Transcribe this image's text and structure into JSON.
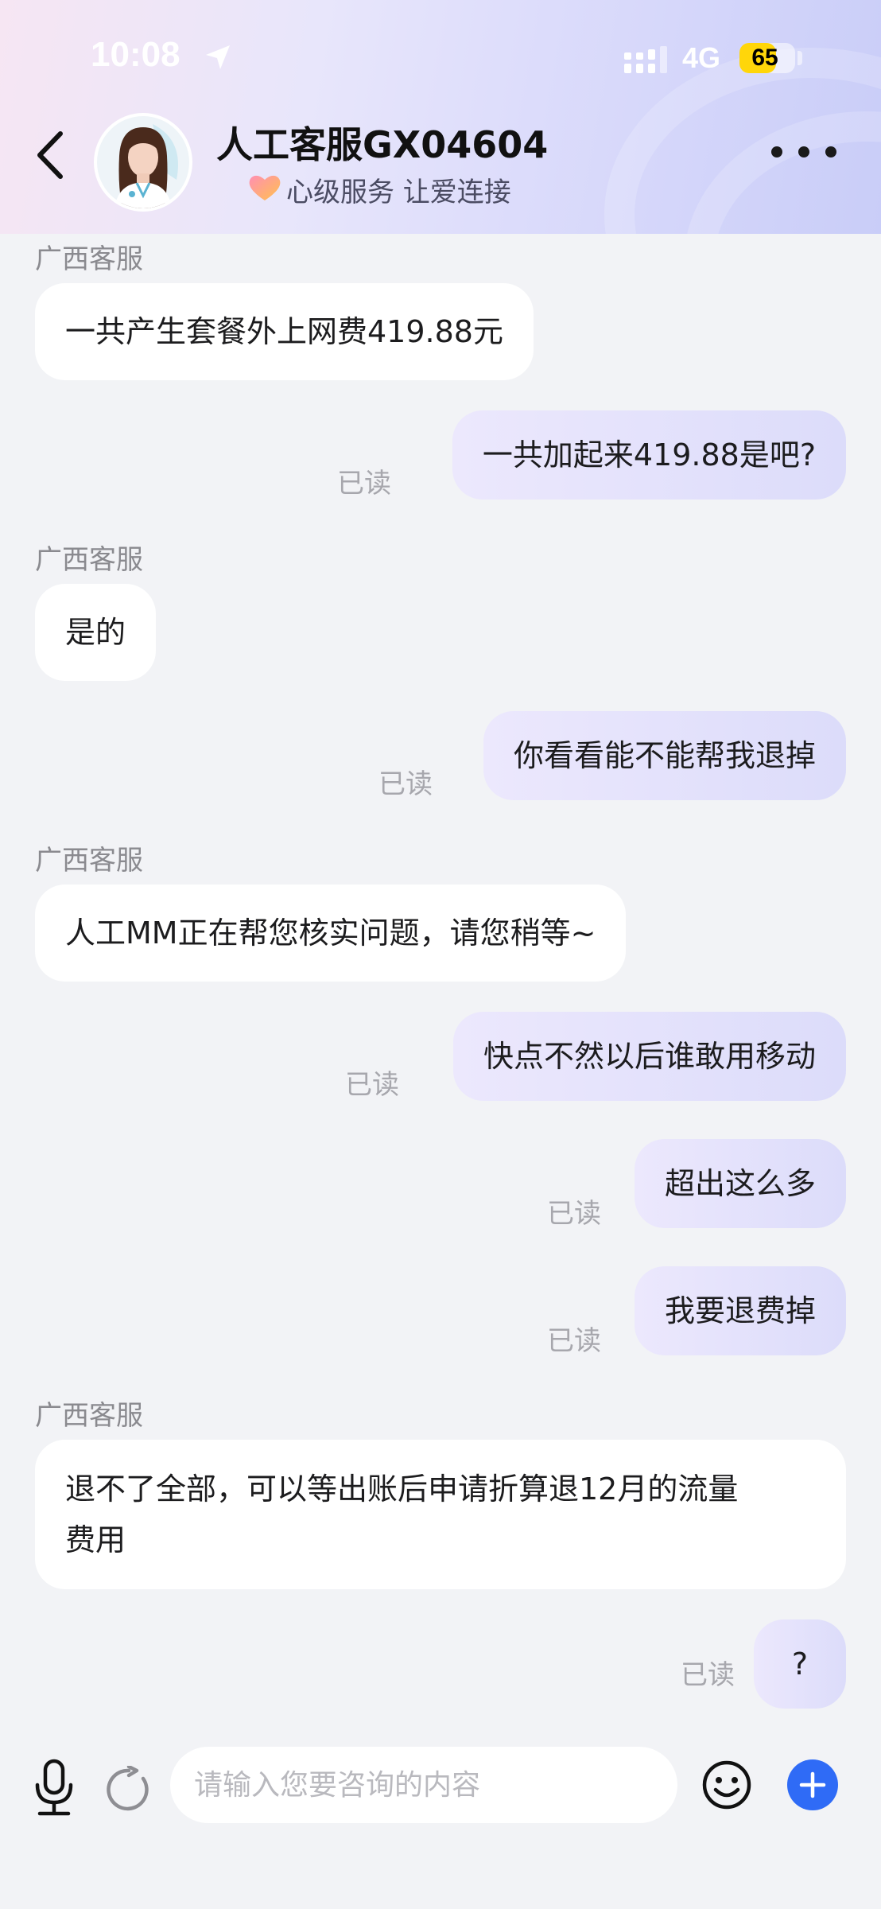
{
  "status_bar": {
    "time": "10:08",
    "network": "4G",
    "battery": "65",
    "battery_level": 0.65
  },
  "header": {
    "title": "人工客服GX04604",
    "subtitle": "心级服务 让爱连接",
    "back_icon": "chevron-left-icon",
    "more_icon": "more-dots-icon"
  },
  "chat": {
    "read_label": "已读",
    "messages": [
      {
        "from": "agent",
        "sender": "广西客服",
        "text": "一共产生套餐外上网费419.88元"
      },
      {
        "from": "me",
        "text": "一共加起来419.88是吧?",
        "status": "已读"
      },
      {
        "from": "agent",
        "sender": "广西客服",
        "text": "是的"
      },
      {
        "from": "me",
        "text": "你看看能不能帮我退掉",
        "status": "已读"
      },
      {
        "from": "agent",
        "sender": "广西客服",
        "text": "人工MM正在帮您核实问题，请您稍等~"
      },
      {
        "from": "me",
        "text": "快点不然以后谁敢用移动",
        "status": "已读"
      },
      {
        "from": "me",
        "text": "超出这么多",
        "status": "已读"
      },
      {
        "from": "me",
        "text": "我要退费掉",
        "status": "已读"
      },
      {
        "from": "agent",
        "sender": "广西客服",
        "text_line1": "退不了全部，可以等出账后申请折算退12月的流量",
        "text_line2": "费用"
      },
      {
        "from": "me",
        "text": "?",
        "status": "已读"
      }
    ]
  },
  "input_bar": {
    "placeholder": "请输入您要咨询的内容",
    "mic_icon": "microphone-icon",
    "refresh_icon": "refresh-icon",
    "emoji_icon": "emoji-icon",
    "plus_icon": "plus-icon"
  },
  "colors": {
    "accent": "#2f6bf6",
    "out_bubble": "#e3e0fc",
    "in_bubble": "#ffffff",
    "background": "#f2f3f6"
  }
}
